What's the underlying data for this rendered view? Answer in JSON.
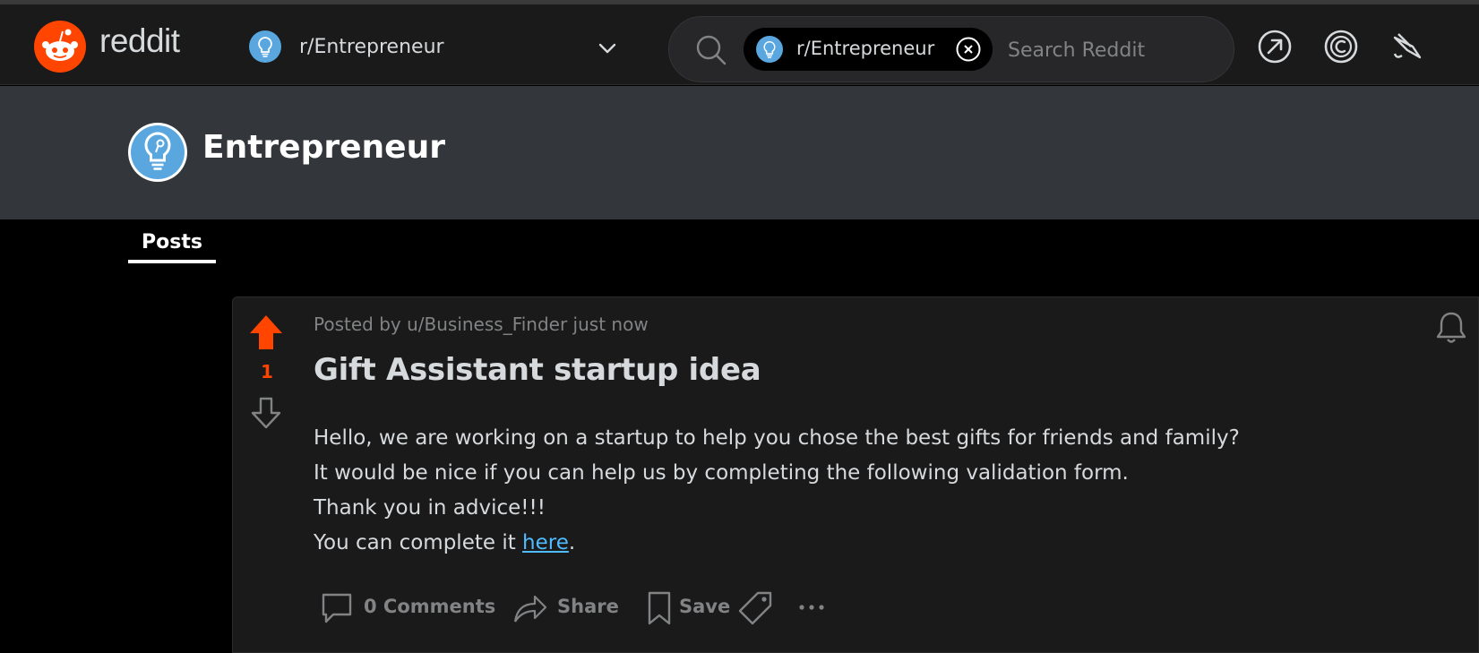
{
  "header": {
    "wordmark": "reddit",
    "community_dropdown": {
      "label": "r/Entrepreneur"
    },
    "search": {
      "chip_label": "r/Entrepreneur",
      "placeholder": "Search Reddit",
      "value": ""
    },
    "icons": [
      "popular-arrow-icon",
      "coins-icon",
      "advertise-icon"
    ]
  },
  "banner": {
    "title": "Entrepreneur"
  },
  "tabs": [
    {
      "label": "Posts",
      "active": true
    }
  ],
  "post": {
    "vote_count": "1",
    "meta": "Posted by u/Business_Finder just now",
    "title": "Gift Assistant startup idea",
    "body_lines": [
      "Hello, we are working on a startup to help you chose the best gifts for friends and family?",
      "It would be nice if you can help us by completing the following validation form.",
      "Thank you in advice!!!"
    ],
    "last_line_prefix": "You can complete it ",
    "link_text": "here",
    "last_line_suffix": ".",
    "actions": {
      "comments": "0 Comments",
      "share": "Share",
      "save": "Save"
    }
  },
  "colors": {
    "brand": "#ff4500",
    "link": "#4fbcff",
    "community_icon": "#5aa7e0",
    "header_bg": "#1a1a1b",
    "banner_bg": "#33363a"
  }
}
